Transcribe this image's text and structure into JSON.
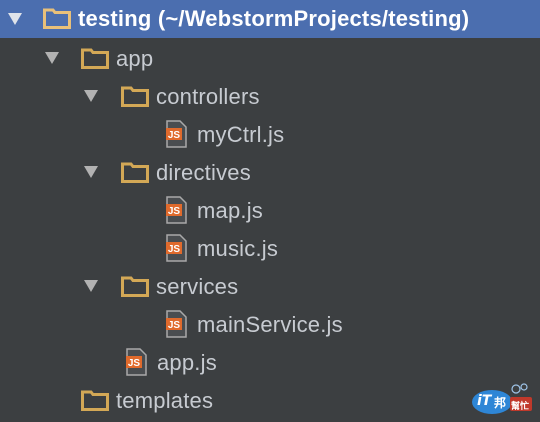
{
  "tree": {
    "root": {
      "name": "testing",
      "path": "(~/WebstormProjects/testing)"
    },
    "app": "app",
    "controllers": "controllers",
    "myCtrl": "myCtrl.js",
    "directives": "directives",
    "map": "map.js",
    "music": "music.js",
    "services": "services",
    "mainService": "mainService.js",
    "appjs": "app.js",
    "templates": "templates"
  },
  "icons": {
    "expanded": "triangle-down-icon",
    "folder": "folder-icon",
    "file": "js-file-icon",
    "js_badge": "JS"
  },
  "watermark": {
    "main": "iT",
    "sub": "邦",
    "help": "幫忙"
  },
  "colors": {
    "background": "#3c3f41",
    "selection": "#4b6eaf",
    "folder": "#d3a856",
    "js_badge": "#e06a2c",
    "text": "#c7cbd1"
  }
}
